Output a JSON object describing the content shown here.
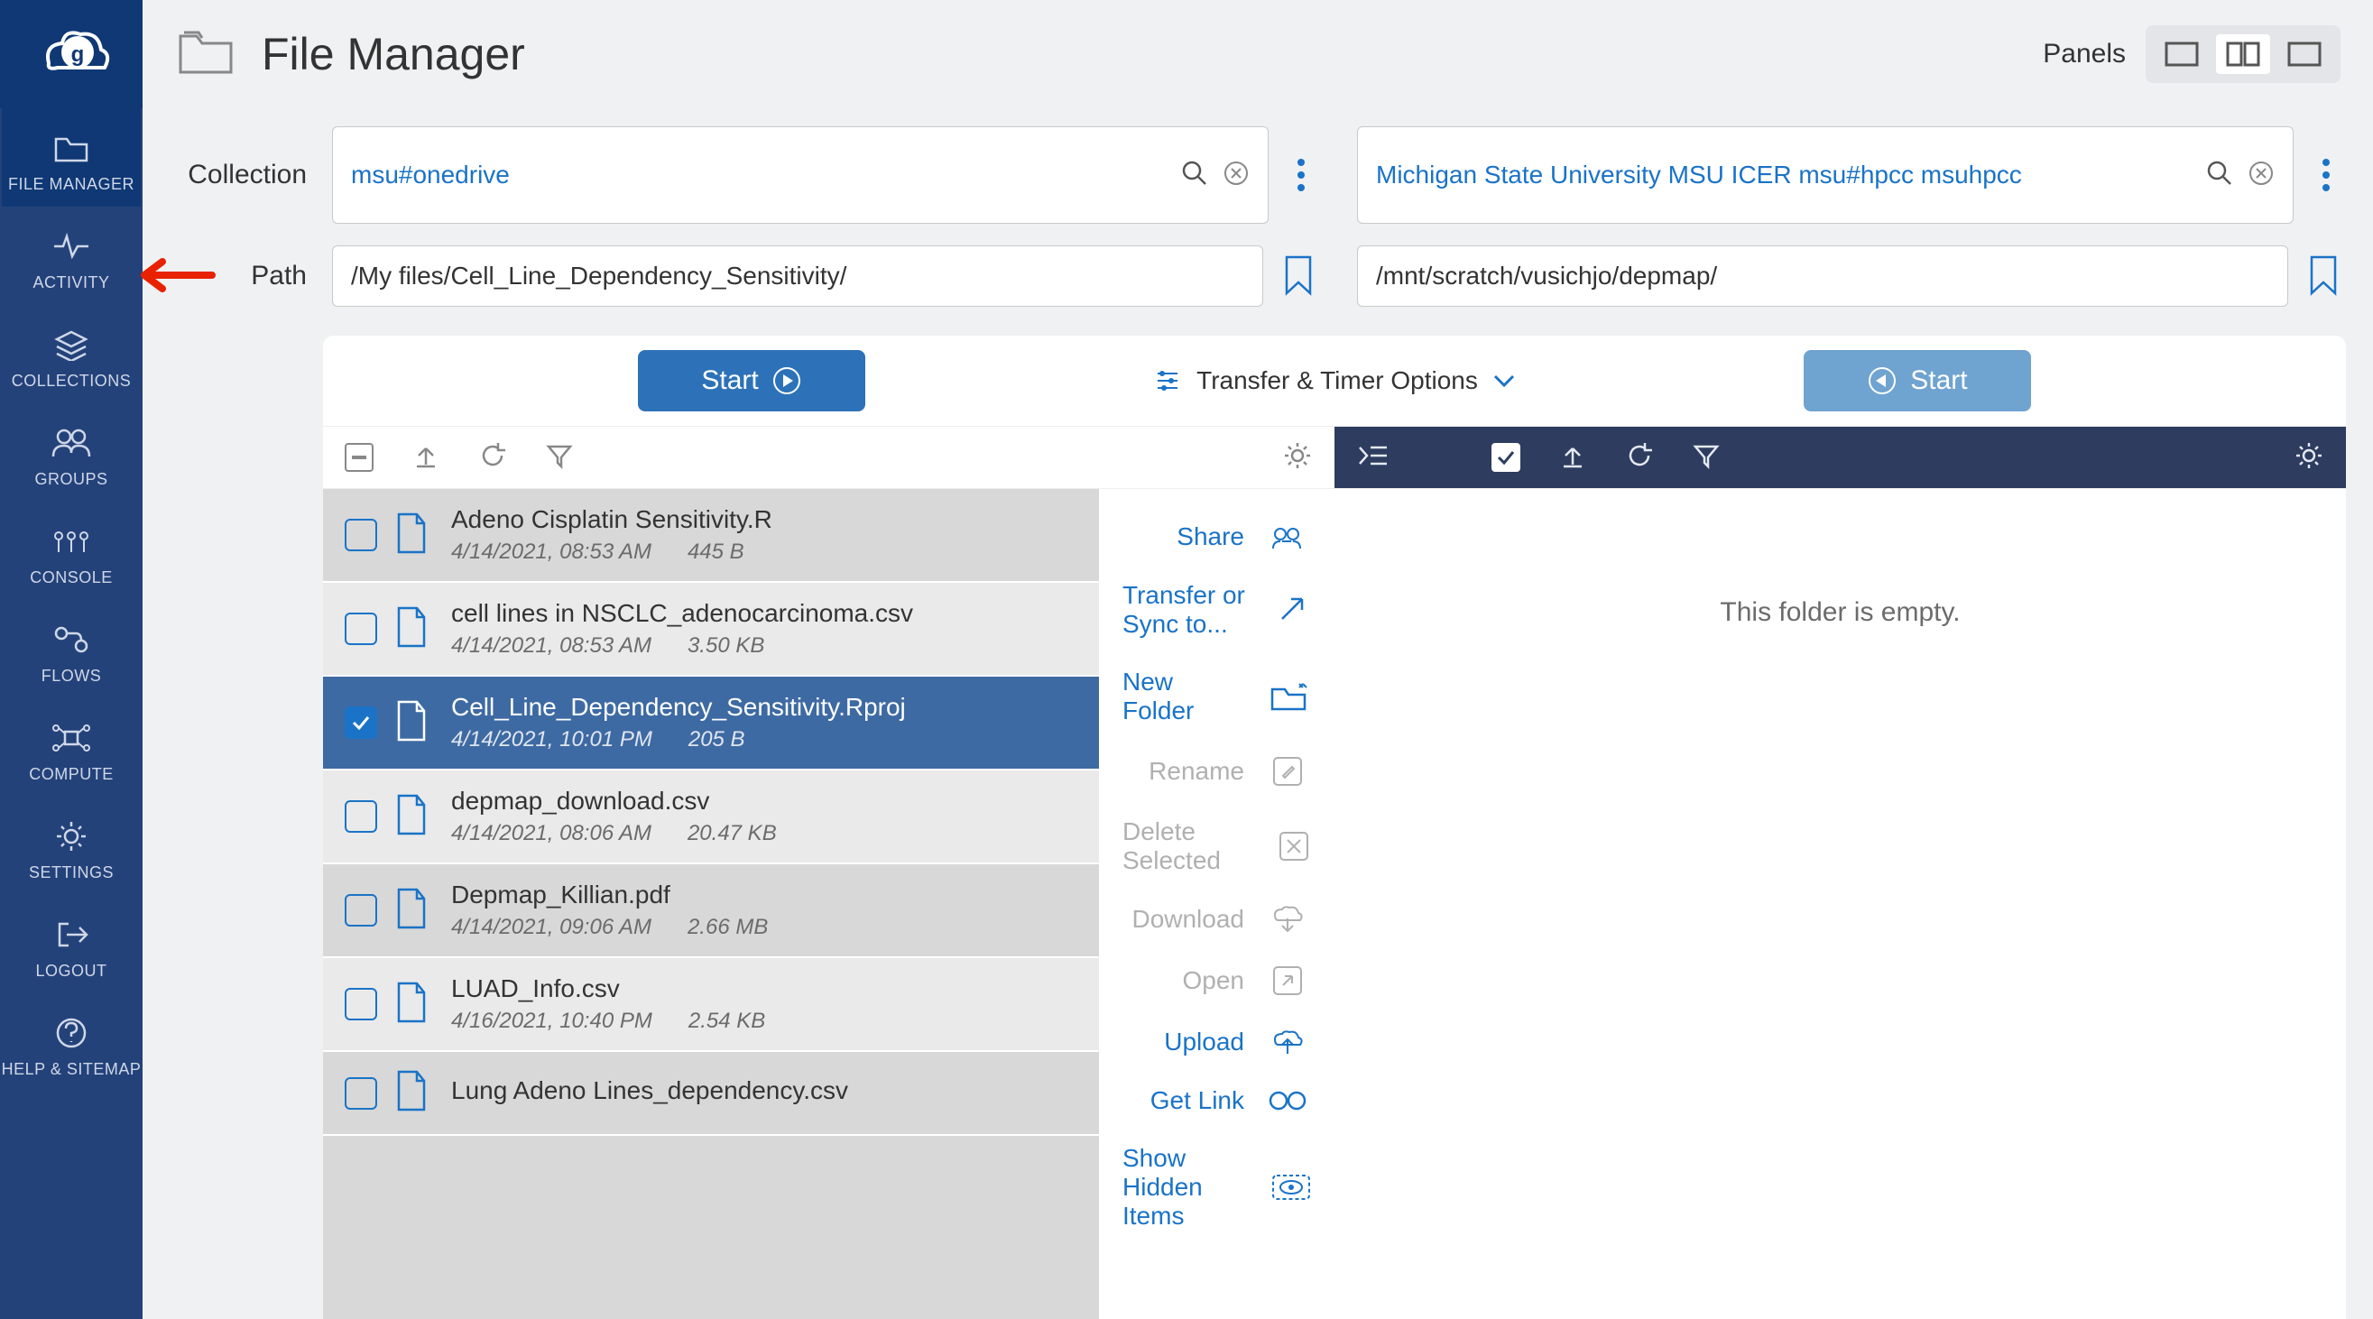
{
  "header": {
    "title": "File Manager",
    "panels_label": "Panels"
  },
  "sidebar": {
    "items": [
      {
        "label": "FILE MANAGER",
        "icon": "folder"
      },
      {
        "label": "ACTIVITY",
        "icon": "activity"
      },
      {
        "label": "COLLECTIONS",
        "icon": "layers"
      },
      {
        "label": "GROUPS",
        "icon": "users"
      },
      {
        "label": "CONSOLE",
        "icon": "console"
      },
      {
        "label": "FLOWS",
        "icon": "flows"
      },
      {
        "label": "COMPUTE",
        "icon": "compute"
      },
      {
        "label": "SETTINGS",
        "icon": "gear"
      },
      {
        "label": "LOGOUT",
        "icon": "logout"
      },
      {
        "label": "HELP & SITEMAP",
        "icon": "help"
      }
    ]
  },
  "labels": {
    "collection": "Collection",
    "path": "Path"
  },
  "left": {
    "collection": "msu#onedrive",
    "path": "/My files/Cell_Line_Dependency_Sensitivity/",
    "start": "Start",
    "files": [
      {
        "name": "Adeno Cisplatin Sensitivity.R",
        "date": "4/14/2021, 08:53 AM",
        "size": "445 B",
        "selected": false
      },
      {
        "name": "cell lines in NSCLC_adenocarcinoma.csv",
        "date": "4/14/2021, 08:53 AM",
        "size": "3.50 KB",
        "selected": false
      },
      {
        "name": "Cell_Line_Dependency_Sensitivity.Rproj",
        "date": "4/14/2021, 10:01 PM",
        "size": "205 B",
        "selected": true
      },
      {
        "name": "depmap_download.csv",
        "date": "4/14/2021, 08:06 AM",
        "size": "20.47 KB",
        "selected": false
      },
      {
        "name": "Depmap_Killian.pdf",
        "date": "4/14/2021, 09:06 AM",
        "size": "2.66 MB",
        "selected": false
      },
      {
        "name": "LUAD_Info.csv",
        "date": "4/16/2021, 10:40 PM",
        "size": "2.54 KB",
        "selected": false
      },
      {
        "name": "Lung Adeno Lines_dependency.csv",
        "date": "",
        "size": "",
        "selected": false
      }
    ],
    "actions": [
      {
        "label": "Share",
        "enabled": true,
        "icon": "share"
      },
      {
        "label": "Transfer or Sync to...",
        "enabled": true,
        "icon": "transfer"
      },
      {
        "label": "New Folder",
        "enabled": true,
        "icon": "new-folder"
      },
      {
        "label": "Rename",
        "enabled": false,
        "icon": "rename"
      },
      {
        "label": "Delete Selected",
        "enabled": false,
        "icon": "delete"
      },
      {
        "label": "Download",
        "enabled": false,
        "icon": "download"
      },
      {
        "label": "Open",
        "enabled": false,
        "icon": "open"
      },
      {
        "label": "Upload",
        "enabled": true,
        "icon": "upload"
      },
      {
        "label": "Get Link",
        "enabled": true,
        "icon": "link"
      },
      {
        "label": "Show Hidden Items",
        "enabled": true,
        "icon": "eye"
      }
    ]
  },
  "right": {
    "collection": "Michigan State University MSU ICER msu#hpcc msuhpcc",
    "path": "/mnt/scratch/vusichjo/depmap/",
    "start": "Start",
    "empty": "This folder is empty."
  },
  "transfer_opts": "Transfer & Timer Options"
}
